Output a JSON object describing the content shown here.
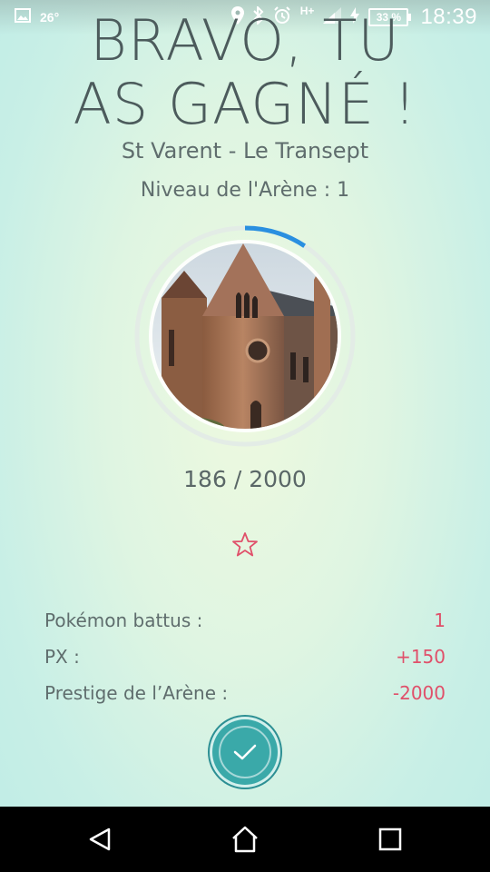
{
  "status_bar": {
    "temperature": "26°",
    "network": "H+",
    "battery": "33 %",
    "time": "18:39"
  },
  "victory": {
    "title": "BRAVO, TU\nAS GAGNÉ !",
    "gym_name": "St Varent - Le Transept",
    "gym_level": "Niveau de l'Arène : 1",
    "prestige_current": 186,
    "prestige_max": 2000,
    "prestige_text": "186 / 2000"
  },
  "stats": [
    {
      "label": "Pokémon battus :",
      "value": "1"
    },
    {
      "label": "PX :",
      "value": "+150"
    },
    {
      "label": "Prestige de l’Arène :",
      "value": "-2000"
    }
  ],
  "colors": {
    "accent_pink": "#e0506a",
    "progress_blue": "#2a8fe0",
    "confirm_teal": "#3aa9a9"
  },
  "icons": {
    "gallery": "image-icon",
    "location": "location-pin-icon",
    "bluetooth": "bluetooth-icon",
    "alarm": "alarm-icon",
    "signal": "signal-icon",
    "charging": "bolt-icon",
    "star": "star-icon",
    "confirm": "check-icon",
    "back": "back-triangle-icon",
    "home": "home-icon",
    "recents": "recents-square-icon"
  }
}
